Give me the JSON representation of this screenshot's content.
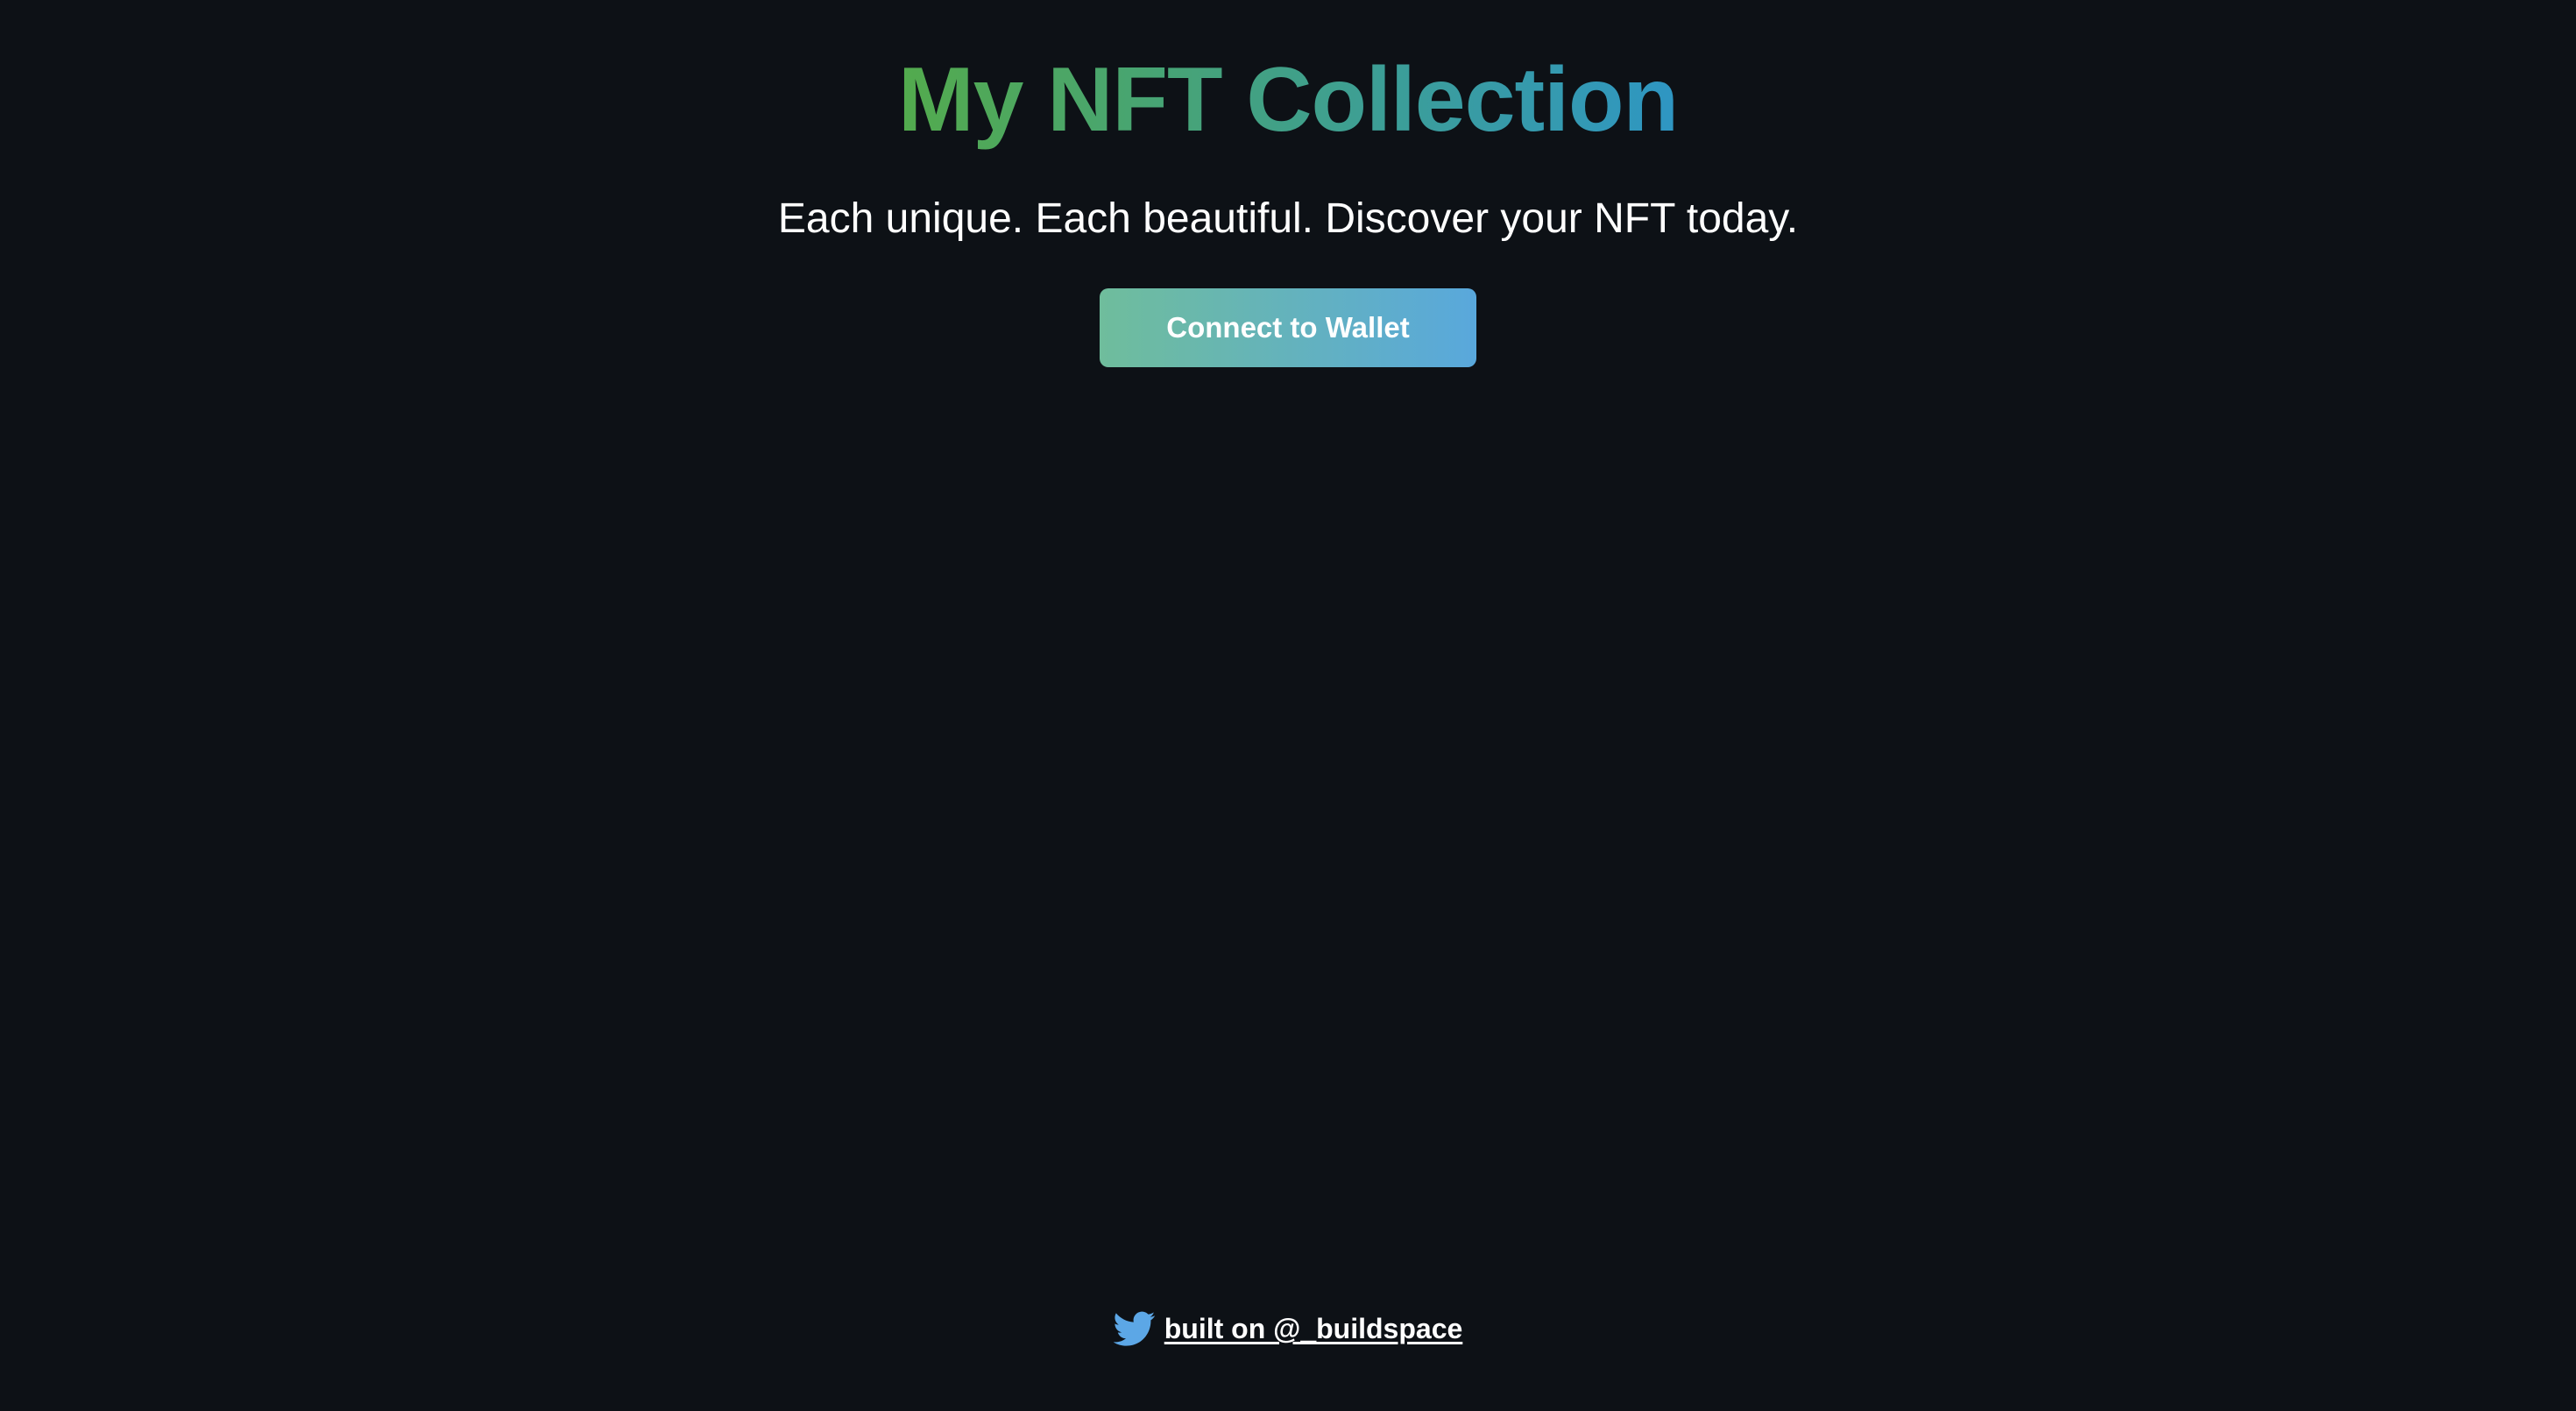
{
  "header": {
    "title": "My NFT Collection",
    "subtitle": "Each unique. Each beautiful. Discover your NFT today."
  },
  "actions": {
    "connect_label": "Connect to Wallet"
  },
  "footer": {
    "icon": "twitter-icon",
    "link_text": "built on @_buildspace"
  },
  "colors": {
    "background": "#0d1116",
    "gradient_start": "#60c657",
    "gradient_end": "#35aee2",
    "twitter_blue": "#5ca7e6"
  }
}
